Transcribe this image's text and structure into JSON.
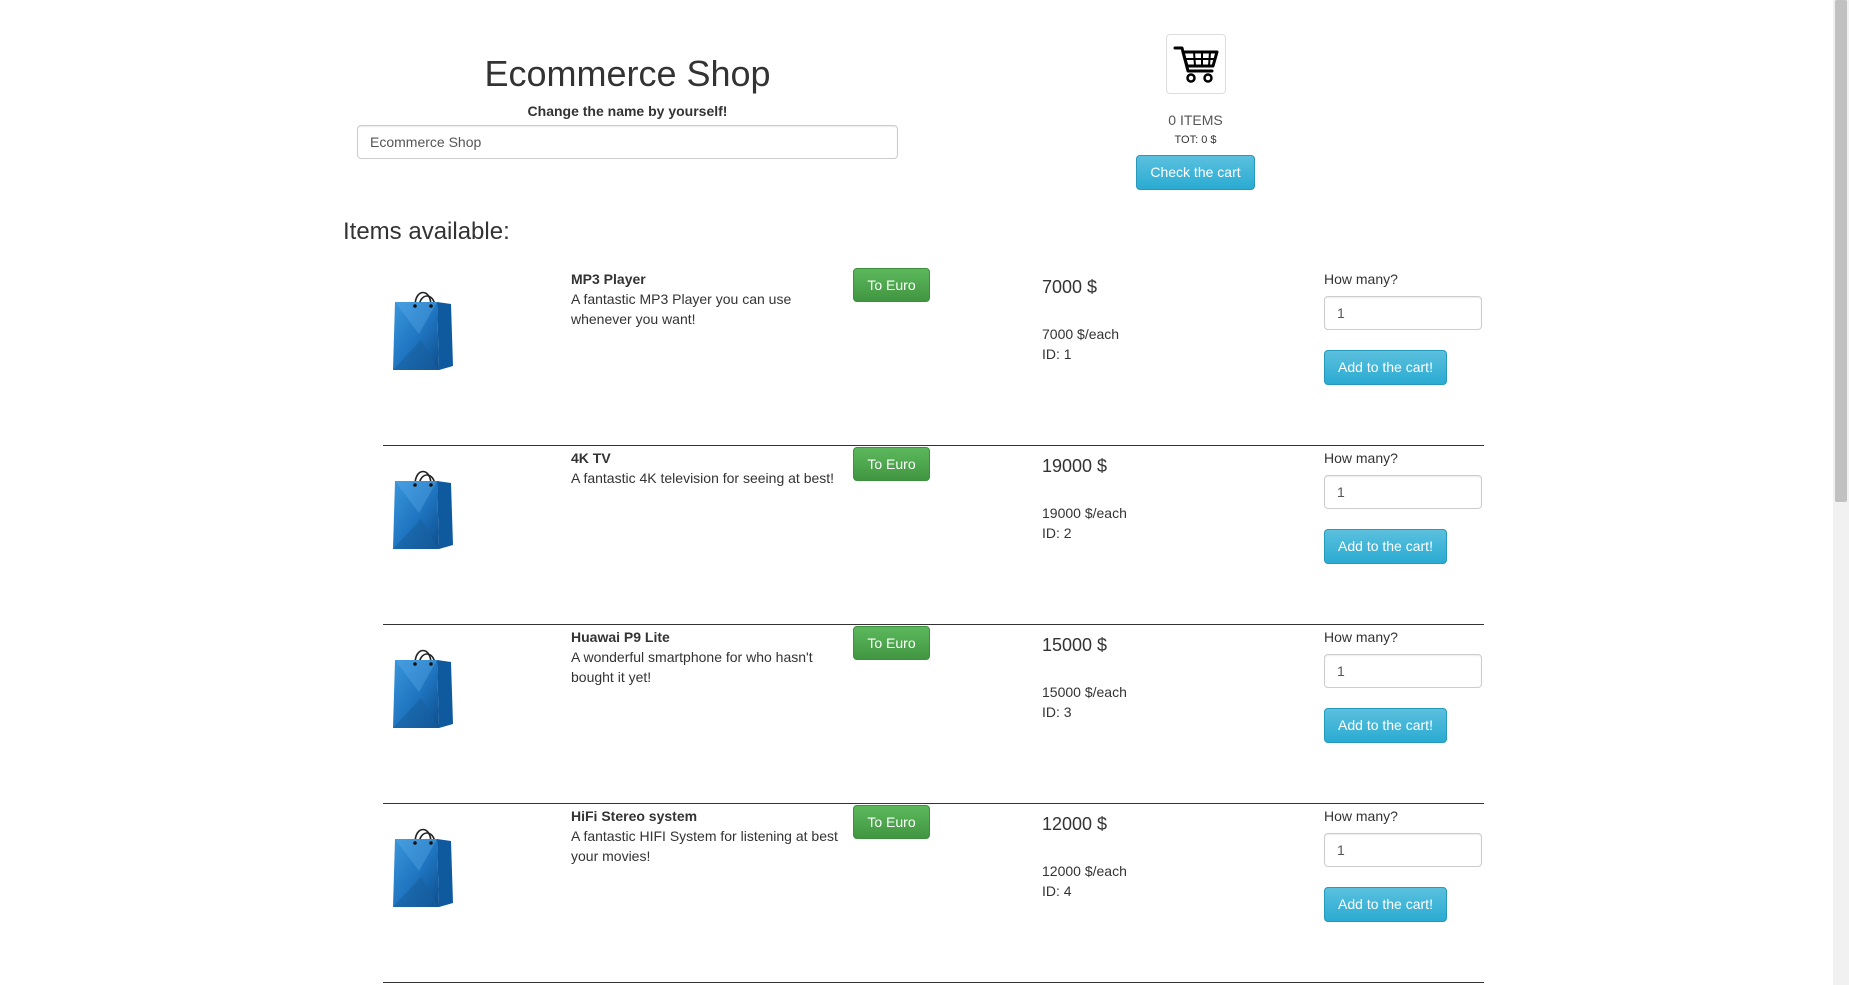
{
  "header": {
    "title": "Ecommerce Shop",
    "name_label": "Change the name by yourself!",
    "name_value": "Ecommerce Shop"
  },
  "cart": {
    "icon": "cart-icon",
    "items_text": "0 ITEMS",
    "total_text": "TOT: 0 $",
    "check_label": "Check the cart"
  },
  "items_heading": "Items available:",
  "colors": {
    "info_button": "#31b0d5",
    "success_button": "#449d44",
    "bag_blue": "#1e73be"
  },
  "items": [
    {
      "icon": "shopping-bag-icon",
      "name": "MP3 Player",
      "description": "A fantastic MP3 Player you can use whenever you want!",
      "convert_label": "To Euro",
      "price": "7000 $",
      "price_each": "7000 $/each",
      "id_text": "ID: 1",
      "qty_label": "How many?",
      "qty_value": "1",
      "add_label": "Add to the cart!"
    },
    {
      "icon": "shopping-bag-icon",
      "name": "4K TV",
      "description": "A fantastic 4K television for seeing at best!",
      "convert_label": "To Euro",
      "price": "19000 $",
      "price_each": "19000 $/each",
      "id_text": "ID: 2",
      "qty_label": "How many?",
      "qty_value": "1",
      "add_label": "Add to the cart!"
    },
    {
      "icon": "shopping-bag-icon",
      "name": "Huawai P9 Lite",
      "description": "A wonderful smartphone for who hasn't bought it yet!",
      "convert_label": "To Euro",
      "price": "15000 $",
      "price_each": "15000 $/each",
      "id_text": "ID: 3",
      "qty_label": "How many?",
      "qty_value": "1",
      "add_label": "Add to the cart!"
    },
    {
      "icon": "shopping-bag-icon",
      "name": "HiFi Stereo system",
      "description": "A fantastic HIFI System for listening at best your movies!",
      "convert_label": "To Euro",
      "price": "12000 $",
      "price_each": "12000 $/each",
      "id_text": "ID: 4",
      "qty_label": "How many?",
      "qty_value": "1",
      "add_label": "Add to the cart!"
    }
  ]
}
